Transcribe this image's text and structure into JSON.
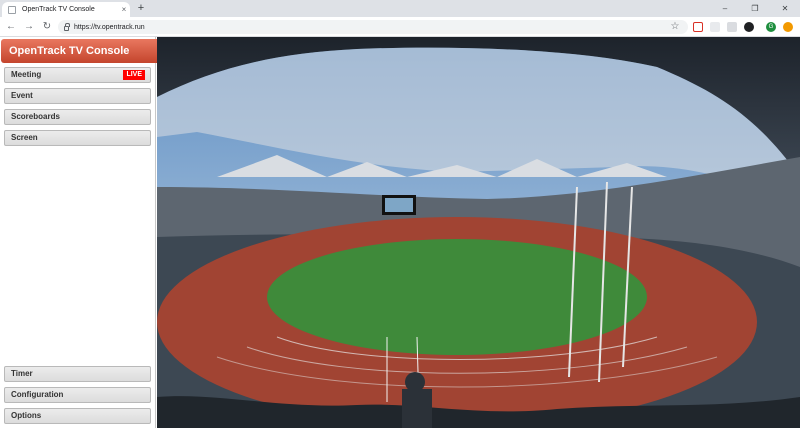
{
  "browser": {
    "tab_title": "OpenTrack TV Console",
    "tab_close": "×",
    "new_tab": "+",
    "url": "tv.opentrack.run",
    "url_scheme": "https://",
    "minimize": "–",
    "maximize": "❐",
    "close": "✕",
    "back": "←",
    "forward": "→",
    "reload": "↻",
    "star": "☆",
    "profile_initial": "G"
  },
  "app": {
    "title": "OpenTrack TV Console",
    "menu_top": [
      {
        "label": "Meeting",
        "badge": "LIVE"
      },
      {
        "label": "Event"
      },
      {
        "label": "Scoreboards"
      },
      {
        "label": "Screen"
      }
    ],
    "menu_bottom": [
      {
        "label": "Timer"
      },
      {
        "label": "Configuration"
      },
      {
        "label": "Options"
      }
    ]
  },
  "colors": {
    "header_top": "#e9775f",
    "header_bottom": "#c4452d",
    "live_badge": "#ff0000",
    "track": "#a14433",
    "infield": "#3f8a3a"
  },
  "icons": [
    "search-icon",
    "lock-icon",
    "star-icon",
    "monitor-icon"
  ]
}
